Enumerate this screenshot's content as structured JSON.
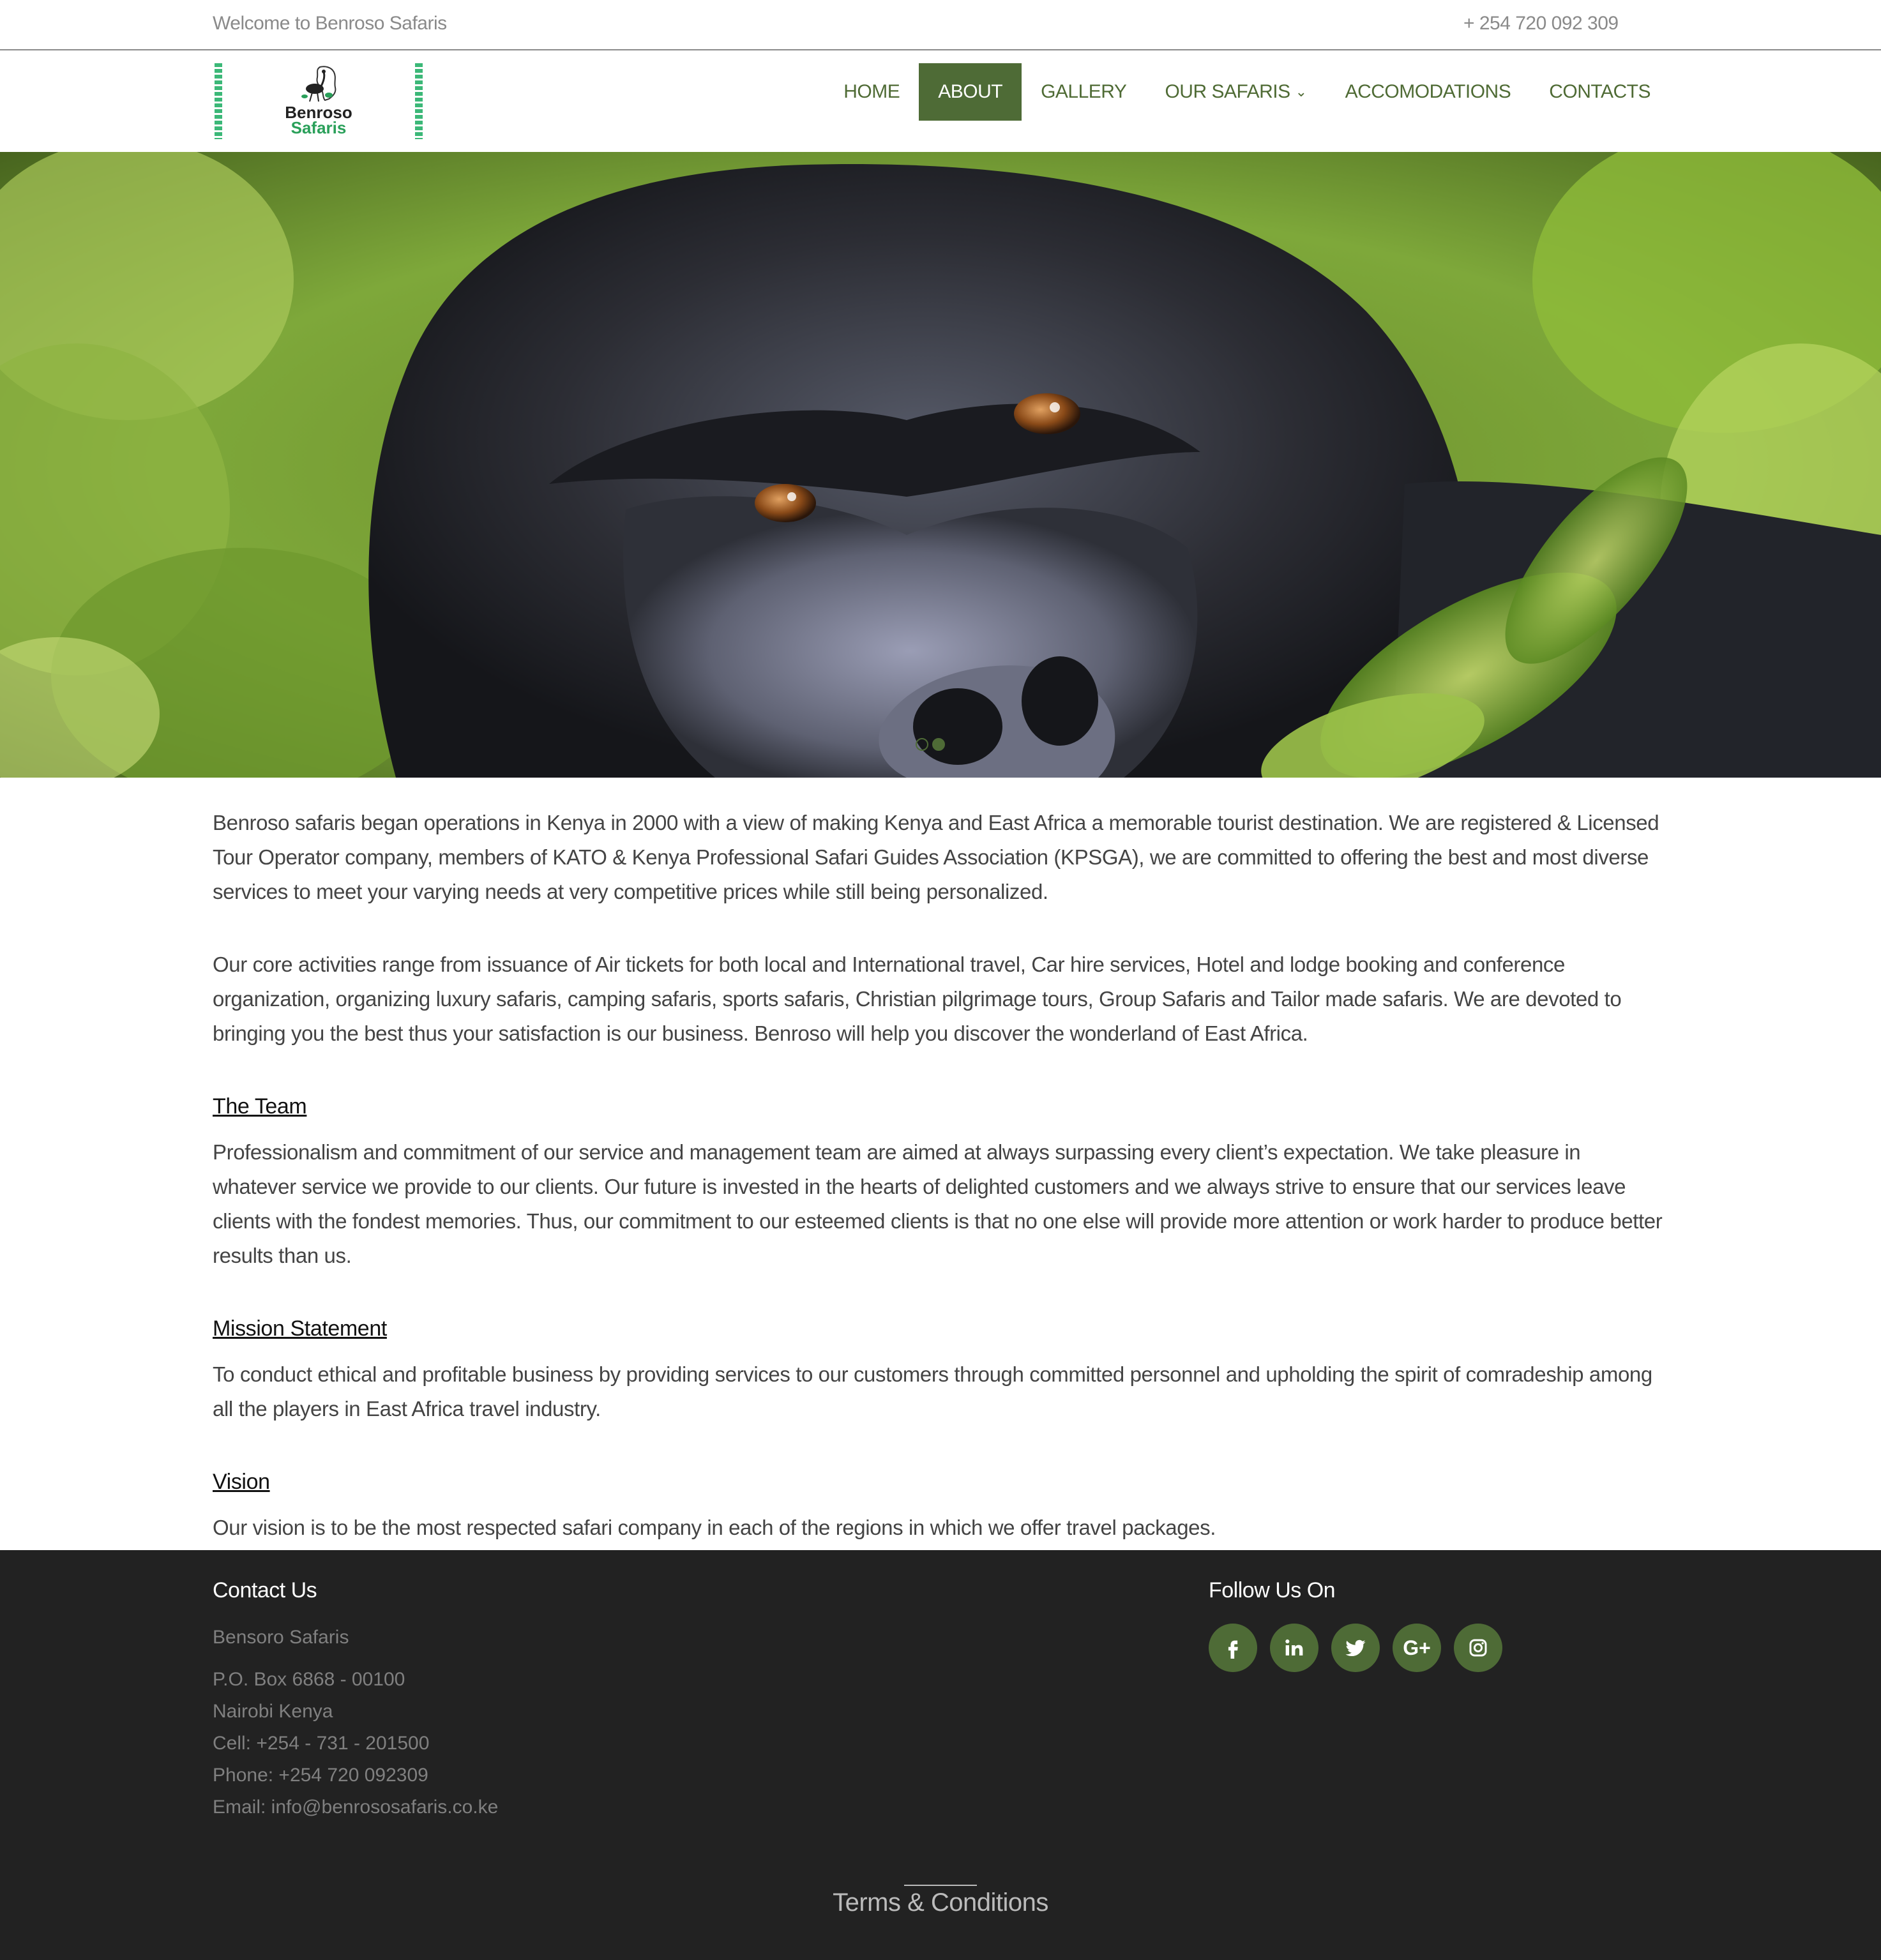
{
  "topbar": {
    "welcome": "Welcome to Benroso Safaris",
    "phone": "+ 254 720 092 309"
  },
  "logo": {
    "line1": "Benroso",
    "line2": "Safaris"
  },
  "nav": {
    "items": [
      {
        "label": "HOME"
      },
      {
        "label": "ABOUT",
        "active": true
      },
      {
        "label": "GALLERY"
      },
      {
        "label": "OUR SAFARIS"
      },
      {
        "label": "ACCOMODATIONS"
      },
      {
        "label": "CONTACTS"
      }
    ]
  },
  "hero": {
    "slides": 2,
    "active_slide": 2
  },
  "content": {
    "intro1": "Benroso safaris began operations in Kenya in 2000 with a view of making Kenya and East Africa a memorable tourist destination. We are registered & Licensed Tour Operator company, members of KATO & Kenya Professional Safari Guides Association (KPSGA), we are committed to offering the best and most diverse services to meet your varying needs at very competitive prices while still being personalized.",
    "intro2": "Our core activities range from issuance of Air tickets for both local and International travel, Car hire services, Hotel and lodge booking and conference organization, organizing luxury safaris, camping safaris, sports safaris, Christian pilgrimage tours, Group Safaris and Tailor made safaris. We are devoted to bringing you the best thus your satisfaction is our business. Benroso will help you discover the wonderland of East Africa.",
    "team_heading": "The Team",
    "team_text": "Professionalism and commitment of our service and management team are aimed at always surpassing every client’s expectation. We take pleasure in whatever service we provide to our clients. Our future is invested in the hearts of delighted customers and we always strive to ensure that our services leave clients with the fondest memories. Thus, our commitment to our esteemed clients is that no one else will provide more attention or work harder to produce better results than us.",
    "mission_heading": "Mission Statement",
    "mission_text": "To conduct ethical and profitable business by providing services to our customers through committed personnel and upholding the spirit of comradeship among all the players in East Africa travel industry.",
    "vision_heading": "Vision",
    "vision_text": "Our vision is to be the most respected safari company in each of the regions in which we offer travel packages."
  },
  "footer": {
    "contact_title": "Contact Us",
    "company": "Bensoro Safaris",
    "box": "P.O. Box 6868 - 00100",
    "city": "Nairobi Kenya",
    "cell": "Cell: +254 - 731 - 201500",
    "phone": "Phone: +254 720 092309",
    "email": "Email: info@benrososafaris.co.ke",
    "follow_title": "Follow Us On",
    "social": [
      {
        "icon": "facebook-icon",
        "glyph": "f"
      },
      {
        "icon": "linkedin-icon",
        "glyph": "in"
      },
      {
        "icon": "twitter-icon",
        "glyph": "t"
      },
      {
        "icon": "google-plus-icon",
        "glyph": "G+"
      },
      {
        "icon": "instagram-icon",
        "glyph": "ig"
      }
    ],
    "terms": "Terms & Conditions"
  },
  "colors": {
    "accent": "#4e6b36",
    "footer_bg": "#222222",
    "logo_green": "#3cb878"
  }
}
